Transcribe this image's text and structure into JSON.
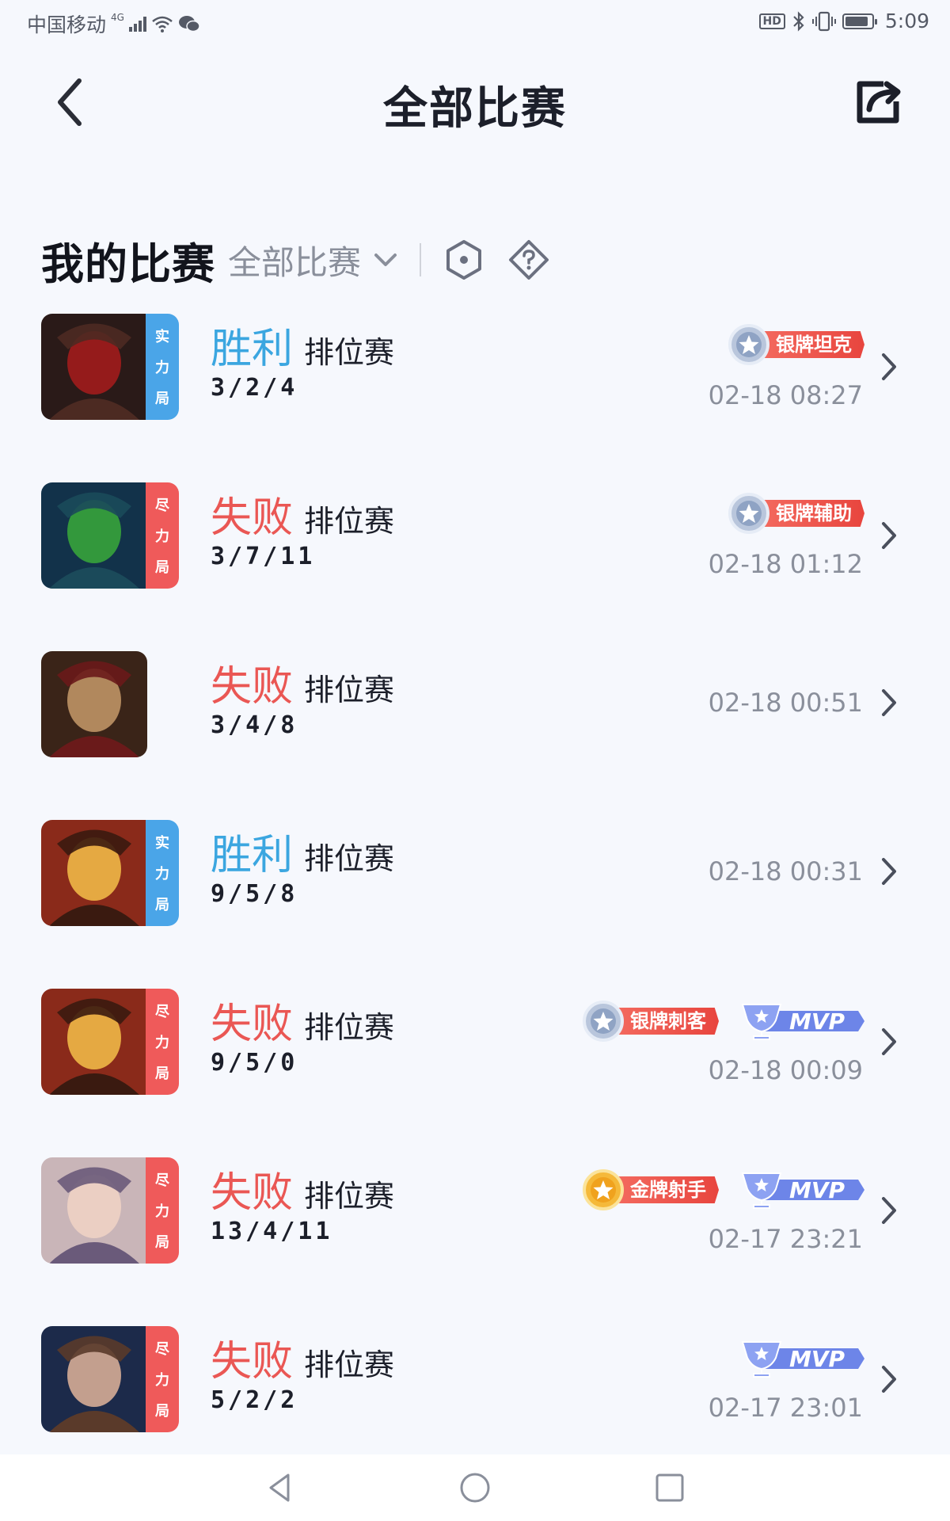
{
  "status_bar": {
    "carrier": "中国移动",
    "network": "4G",
    "hd": "HD",
    "time": "5:09"
  },
  "header": {
    "title": "全部比赛",
    "back_icon": "chevron-left-icon",
    "share_icon": "share-icon"
  },
  "section": {
    "title": "我的比赛",
    "filter_label": "全部比赛",
    "icons": [
      "hexagon-icon",
      "diamond-question-icon"
    ]
  },
  "colors": {
    "win": "#3ba6e0",
    "loss": "#ea5754",
    "tag_blue": "#4aa5e8",
    "tag_red": "#ef5a5a"
  },
  "matches": [
    {
      "result": "胜利",
      "outcome": "win",
      "mode": "排位赛",
      "kda": "3/2/4",
      "tag": [
        "实",
        "力",
        "局"
      ],
      "tag_color": "blue",
      "badge": "银牌坦克",
      "badge_medal": "silver",
      "mvp": "",
      "time": "02-18 08:27"
    },
    {
      "result": "失败",
      "outcome": "loss",
      "mode": "排位赛",
      "kda": "3/7/11",
      "tag": [
        "尽",
        "力",
        "局"
      ],
      "tag_color": "red",
      "badge": "银牌辅助",
      "badge_medal": "silver",
      "mvp": "",
      "time": "02-18 01:12"
    },
    {
      "result": "失败",
      "outcome": "loss",
      "mode": "排位赛",
      "kda": "3/4/8",
      "tag": [],
      "tag_color": "",
      "badge": "",
      "badge_medal": "",
      "mvp": "",
      "time": "02-18 00:51"
    },
    {
      "result": "胜利",
      "outcome": "win",
      "mode": "排位赛",
      "kda": "9/5/8",
      "tag": [
        "实",
        "力",
        "局"
      ],
      "tag_color": "blue",
      "badge": "",
      "badge_medal": "",
      "mvp": "",
      "time": "02-18 00:31"
    },
    {
      "result": "失败",
      "outcome": "loss",
      "mode": "排位赛",
      "kda": "9/5/0",
      "tag": [
        "尽",
        "力",
        "局"
      ],
      "tag_color": "red",
      "badge": "银牌刺客",
      "badge_medal": "silver",
      "mvp": "MVP",
      "time": "02-18 00:09"
    },
    {
      "result": "失败",
      "outcome": "loss",
      "mode": "排位赛",
      "kda": "13/4/11",
      "tag": [
        "尽",
        "力",
        "局"
      ],
      "tag_color": "red",
      "badge": "金牌射手",
      "badge_medal": "gold",
      "mvp": "MVP",
      "time": "02-17 23:21"
    },
    {
      "result": "失败",
      "outcome": "loss",
      "mode": "排位赛",
      "kda": "5/2/2",
      "tag": [
        "尽",
        "力",
        "局"
      ],
      "tag_color": "red",
      "badge": "",
      "badge_medal": "",
      "mvp": "MVP",
      "time": "02-17 23:01"
    }
  ],
  "nav_bar": {
    "icons": [
      "back-triangle-icon",
      "home-circle-icon",
      "recents-square-icon"
    ]
  }
}
